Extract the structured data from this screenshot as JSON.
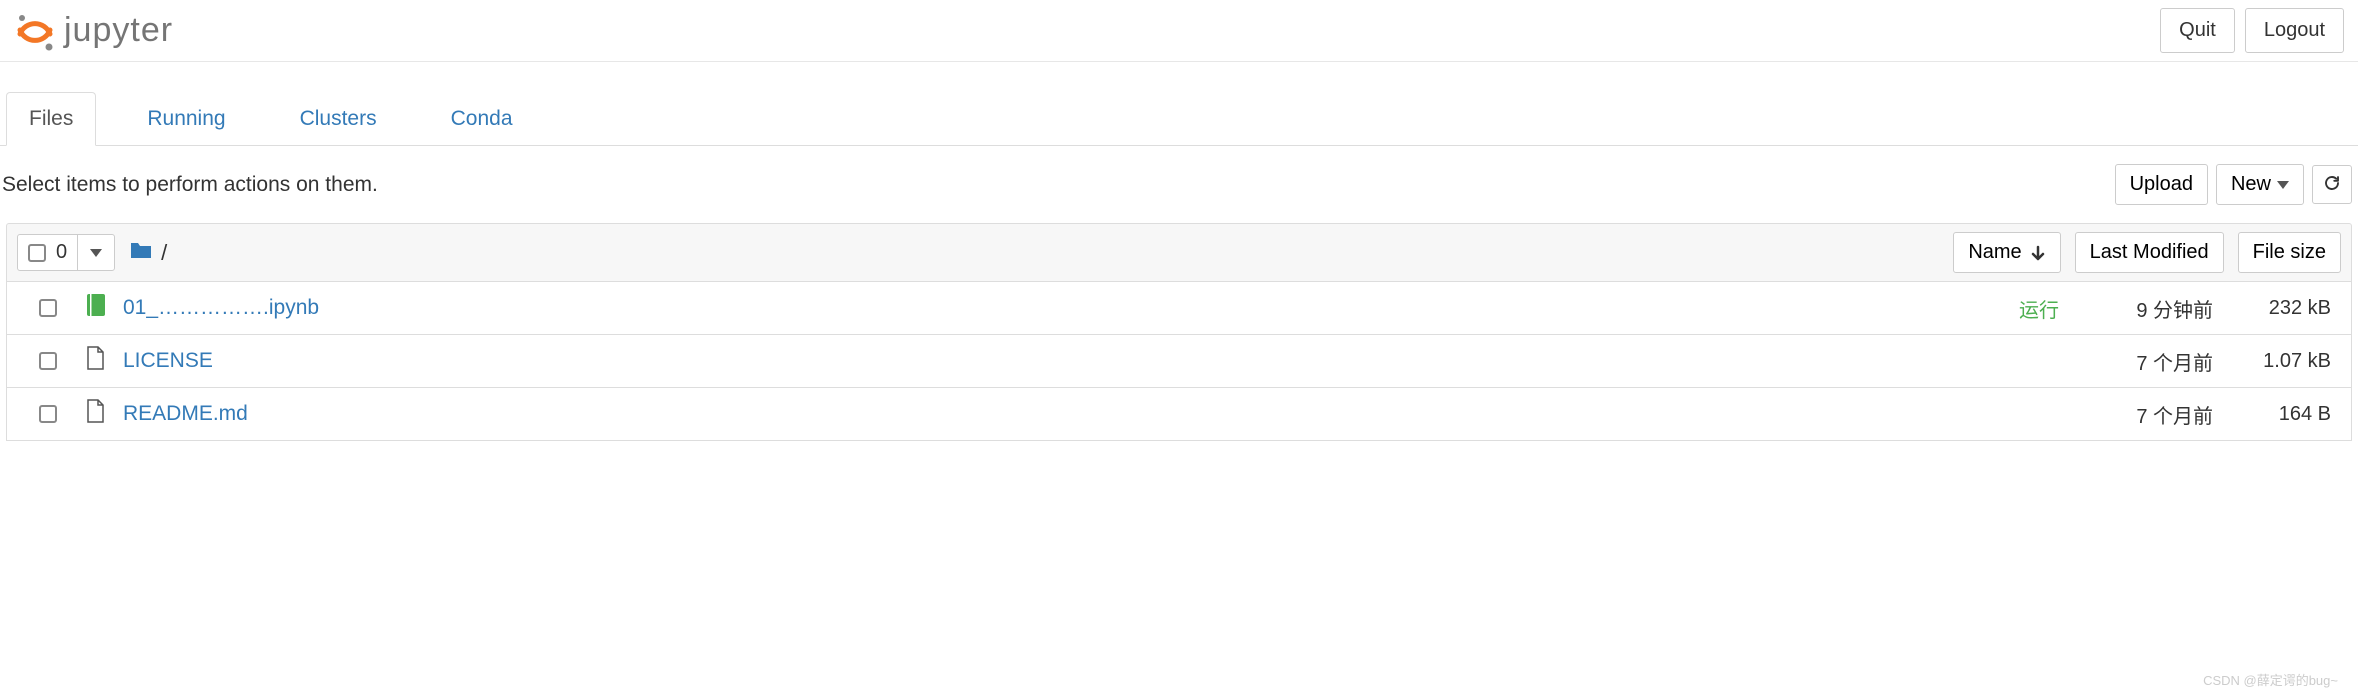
{
  "header": {
    "logo_text": "jupyter",
    "quit": "Quit",
    "logout": "Logout"
  },
  "tabs": {
    "files": "Files",
    "running": "Running",
    "clusters": "Clusters",
    "conda": "Conda"
  },
  "toolbar": {
    "hint": "Select items to perform actions on them.",
    "upload": "Upload",
    "new": "New"
  },
  "list_header": {
    "selected_count": "0",
    "breadcrumb": "/",
    "name": "Name",
    "last_modified": "Last Modified",
    "file_size": "File size"
  },
  "files": [
    {
      "name": "01_…………….ipynb",
      "type": "notebook",
      "status": "运行",
      "modified": "9 分钟前",
      "size": "232 kB"
    },
    {
      "name": "LICENSE",
      "type": "file",
      "status": "",
      "modified": "7 个月前",
      "size": "1.07 kB"
    },
    {
      "name": "README.md",
      "type": "file",
      "status": "",
      "modified": "7 个月前",
      "size": "164 B"
    }
  ],
  "watermark": "CSDN @薛定谔的bug~"
}
